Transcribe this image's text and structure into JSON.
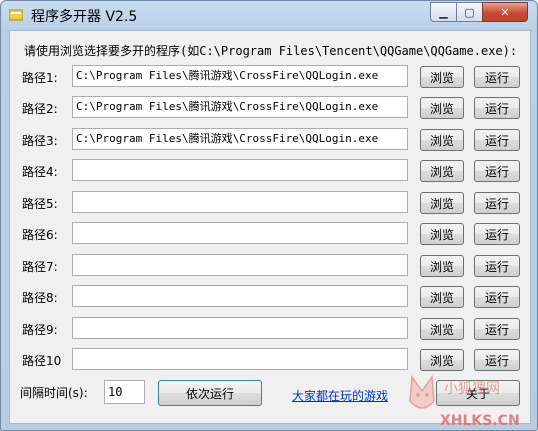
{
  "window": {
    "title": "程序多开器 V2.5",
    "close_glyph": "✕",
    "min_glyph": "▁",
    "max_glyph": "▢"
  },
  "hint": "请使用浏览选择要多开的程序(如C:\\Program Files\\Tencent\\QQGame\\QQGame.exe):",
  "rows": [
    {
      "label": "路径1:",
      "value": "C:\\Program Files\\腾讯游戏\\CrossFire\\QQLogin.exe"
    },
    {
      "label": "路径2:",
      "value": "C:\\Program Files\\腾讯游戏\\CrossFire\\QQLogin.exe"
    },
    {
      "label": "路径3:",
      "value": "C:\\Program Files\\腾讯游戏\\CrossFire\\QQLogin.exe"
    },
    {
      "label": "路径4:",
      "value": ""
    },
    {
      "label": "路径5:",
      "value": ""
    },
    {
      "label": "路径6:",
      "value": ""
    },
    {
      "label": "路径7:",
      "value": ""
    },
    {
      "label": "路径8:",
      "value": ""
    },
    {
      "label": "路径9:",
      "value": ""
    },
    {
      "label": "路径10",
      "value": ""
    }
  ],
  "buttons": {
    "browse": "浏览",
    "run": "运行",
    "sequential_run": "依次运行",
    "about": "关于"
  },
  "interval": {
    "label": "间隔时间(s):",
    "value": "10"
  },
  "link": "大家都在玩的游戏",
  "watermark": {
    "text": "XHLKS.CN",
    "brand": "小狐狸网"
  },
  "colors": {
    "link": "#0033cc",
    "close_button": "#c84b34"
  }
}
